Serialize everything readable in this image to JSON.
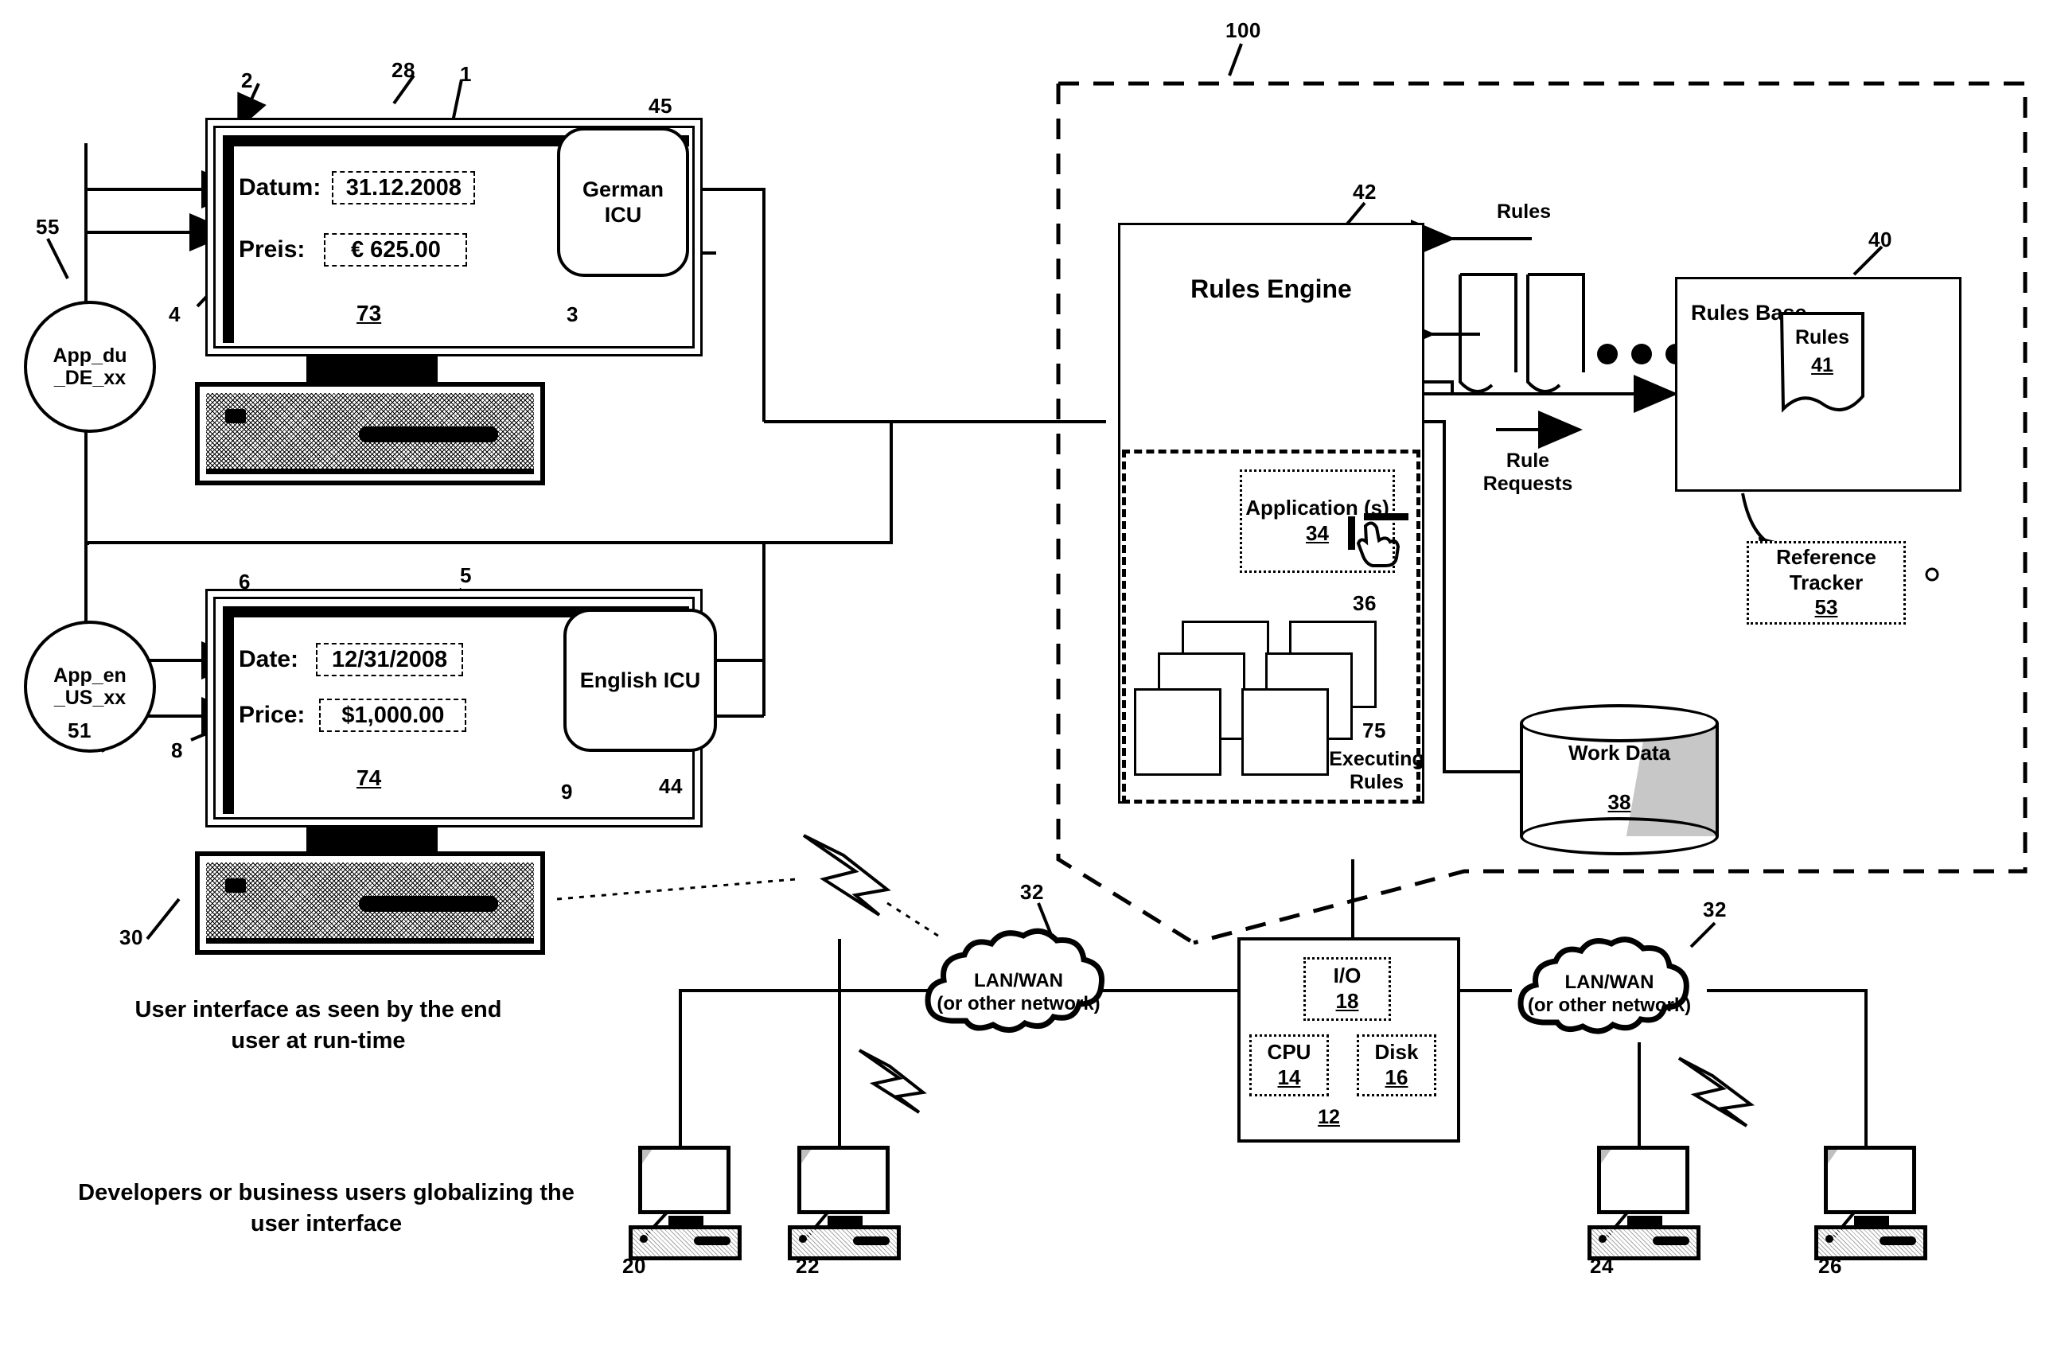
{
  "figure": {
    "system_ref": "100",
    "captions": [
      "User interface as seen by the end\nuser at run-time",
      "Developers or business users globalizing the\nuser interface"
    ]
  },
  "german_ui": {
    "screen_ref": "73",
    "monitor_ref": "28",
    "bezel_ref": "2",
    "fields": [
      {
        "label": "Datum:",
        "value": "31.12.2008",
        "label_ref": "2",
        "value_ref": "1"
      },
      {
        "label": "Preis:",
        "value": "€ 625.00",
        "label_ref": "4",
        "value_ref": "3"
      }
    ],
    "locale_circle": {
      "line1": "App_du",
      "line2": "_DE_xx",
      "ref": "55"
    },
    "icu": {
      "line1": "German",
      "line2": "ICU",
      "ref": "45"
    }
  },
  "english_ui": {
    "screen_ref": "74",
    "keyboard_ref": "30",
    "fields": [
      {
        "label": "Date:",
        "value": "12/31/2008",
        "label_ref": "6",
        "value_ref": "5"
      },
      {
        "label": "Price:",
        "value": "$1,000.00",
        "label_ref": "8",
        "value_ref": "9"
      }
    ],
    "locale_circle": {
      "line1": "App_en",
      "line2": "_US_xx",
      "ref": "51"
    },
    "icu": {
      "line1": "English ICU",
      "line2": "",
      "ref": "44"
    }
  },
  "rules_engine": {
    "title": "Rules Engine",
    "ref": "42",
    "application": {
      "title": "Application (s)",
      "ref": "34",
      "cursor_ref": "36"
    },
    "executing_rules": {
      "label": "Executing\nRules",
      "ref": "75"
    },
    "flow_labels": {
      "rules": "Rules",
      "rule_requests": "Rule\nRequests"
    }
  },
  "rules_base": {
    "title": "Rules Base",
    "ref": "40",
    "rules_doc": {
      "title": "Rules",
      "ref": "41"
    }
  },
  "reference_tracker": {
    "line1": "Reference",
    "line2": "Tracker",
    "ref": "53"
  },
  "work_data": {
    "title": "Work Data",
    "ref": "38"
  },
  "server": {
    "ref": "12",
    "components": [
      {
        "title": "I/O",
        "ref": "18"
      },
      {
        "title": "CPU",
        "ref": "14"
      },
      {
        "title": "Disk",
        "ref": "16"
      }
    ]
  },
  "networks": [
    {
      "line1": "LAN/WAN",
      "line2": "(or other network)",
      "ref": "32"
    },
    {
      "line1": "LAN/WAN",
      "line2": "(or other network)",
      "ref": "32"
    }
  ],
  "client_workstations": [
    {
      "ref": "20"
    },
    {
      "ref": "22"
    },
    {
      "ref": "24"
    },
    {
      "ref": "26"
    }
  ],
  "colors": {
    "ink": "#000000",
    "paper": "#ffffff"
  }
}
